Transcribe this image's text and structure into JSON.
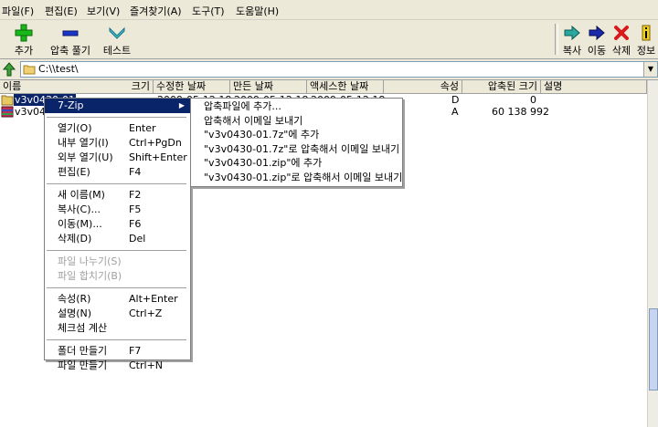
{
  "menubar": {
    "items": [
      "파일(F)",
      "편집(E)",
      "보기(V)",
      "즐겨찾기(A)",
      "도구(T)",
      "도움말(H)"
    ]
  },
  "toolbar": {
    "left": [
      "추가",
      "압축 풀기",
      "테스트"
    ],
    "right": [
      "복사",
      "이동",
      "삭제",
      "정보"
    ]
  },
  "address": {
    "path": "C:\\\\test\\"
  },
  "columns": [
    "이름",
    "크기",
    "수정한 날짜",
    "만든 날짜",
    "액세스한 날짜",
    "속성",
    "압축된 크기",
    "설명"
  ],
  "files": [
    {
      "name": "v3v0430-01",
      "size": "",
      "modified": "2009-05-12 18...",
      "created": "2009-05-12 18...",
      "accessed": "2009-05-12 18...",
      "attr": "D",
      "packed": "0"
    },
    {
      "name": "v3v0430-01.7z",
      "size": "",
      "modified": "",
      "created": "",
      "accessed": "",
      "attr": "A",
      "packed": "60 138 992"
    }
  ],
  "context_menu": {
    "items": [
      {
        "label": "7-Zip",
        "shortcut": "",
        "selected": true,
        "submenu": true
      },
      {
        "sep": true
      },
      {
        "label": "열기(O)",
        "shortcut": "Enter"
      },
      {
        "label": "내부 열기(I)",
        "shortcut": "Ctrl+PgDn"
      },
      {
        "label": "외부 열기(U)",
        "shortcut": "Shift+Enter"
      },
      {
        "label": "편집(E)",
        "shortcut": "F4"
      },
      {
        "sep": true
      },
      {
        "label": "새 이름(M)",
        "shortcut": "F2"
      },
      {
        "label": "복사(C)...",
        "shortcut": "F5"
      },
      {
        "label": "이동(M)...",
        "shortcut": "F6"
      },
      {
        "label": "삭제(D)",
        "shortcut": "Del"
      },
      {
        "sep": true
      },
      {
        "label": "파일 나누기(S)",
        "shortcut": "",
        "disabled": true
      },
      {
        "label": "파일 합치기(B)",
        "shortcut": "",
        "disabled": true
      },
      {
        "sep": true
      },
      {
        "label": "속성(R)",
        "shortcut": "Alt+Enter"
      },
      {
        "label": "설명(N)",
        "shortcut": "Ctrl+Z"
      },
      {
        "label": "체크섬 계산",
        "shortcut": ""
      },
      {
        "sep": true
      },
      {
        "label": "폴더 만들기",
        "shortcut": "F7"
      },
      {
        "label": "파일 만들기",
        "shortcut": "Ctrl+N"
      }
    ]
  },
  "submenu": {
    "items": [
      "압축파일에 추가...",
      "압축해서 이메일 보내기",
      "\"v3v0430-01.7z\"에 추가",
      "\"v3v0430-01.7z\"로 압축해서 이메일 보내기",
      "\"v3v0430-01.zip\"에 추가",
      "\"v3v0430-01.zip\"로 압축해서 이메일 보내기"
    ]
  },
  "colors": {
    "selection": "#0a246a",
    "chrome": "#ece9d8"
  }
}
